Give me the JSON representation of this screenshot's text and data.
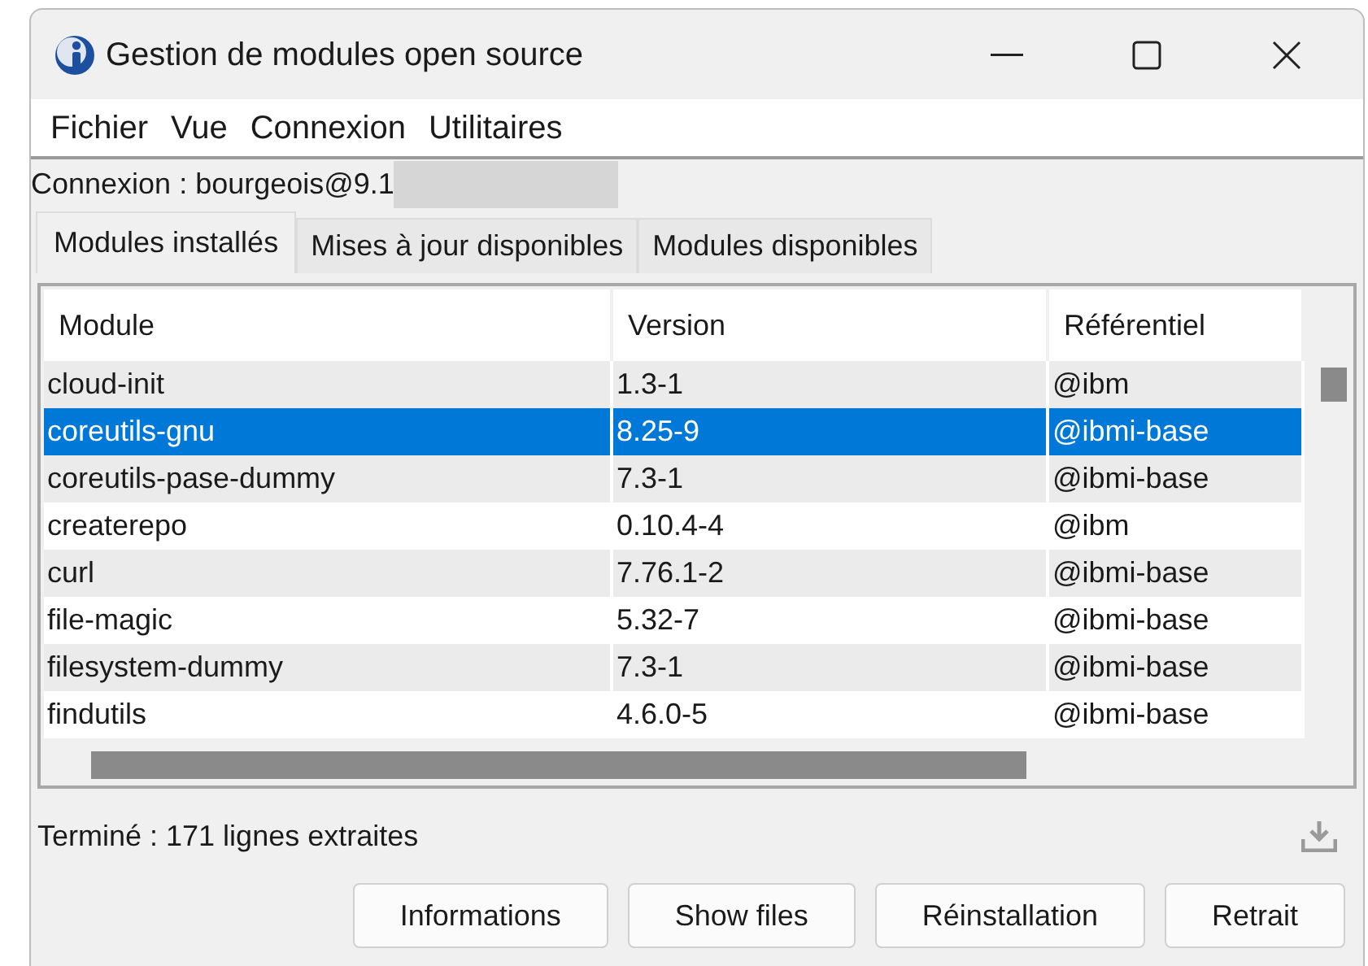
{
  "window": {
    "title": "Gestion de modules open source"
  },
  "menu": [
    "Fichier",
    "Vue",
    "Connexion",
    "Utilitaires"
  ],
  "connection": "Connexion : bourgeois@9.1",
  "tabs": [
    {
      "label": "Modules installés",
      "selected": true
    },
    {
      "label": "Mises à jour disponibles",
      "selected": false
    },
    {
      "label": "Modules disponibles",
      "selected": false
    }
  ],
  "table": {
    "columns": [
      "Module",
      "Version",
      "Référentiel"
    ],
    "rows": [
      {
        "cells": [
          "cloud-init",
          "1.3-1",
          "@ibm"
        ],
        "selected": false
      },
      {
        "cells": [
          "coreutils-gnu",
          "8.25-9",
          "@ibmi-base"
        ],
        "selected": true
      },
      {
        "cells": [
          "coreutils-pase-dummy",
          "7.3-1",
          "@ibmi-base"
        ],
        "selected": false
      },
      {
        "cells": [
          "createrepo",
          "0.10.4-4",
          "@ibm"
        ],
        "selected": false
      },
      {
        "cells": [
          "curl",
          "7.76.1-2",
          "@ibmi-base"
        ],
        "selected": false
      },
      {
        "cells": [
          "file-magic",
          "5.32-7",
          "@ibmi-base"
        ],
        "selected": false
      },
      {
        "cells": [
          "filesystem-dummy",
          "7.3-1",
          "@ibmi-base"
        ],
        "selected": false
      },
      {
        "cells": [
          "findutils",
          "4.6.0-5",
          "@ibmi-base"
        ],
        "selected": false
      }
    ]
  },
  "status": "Terminé : 171 lignes extraites",
  "buttons": [
    "Informations",
    "Show files",
    "Réinstallation",
    "Retrait"
  ]
}
